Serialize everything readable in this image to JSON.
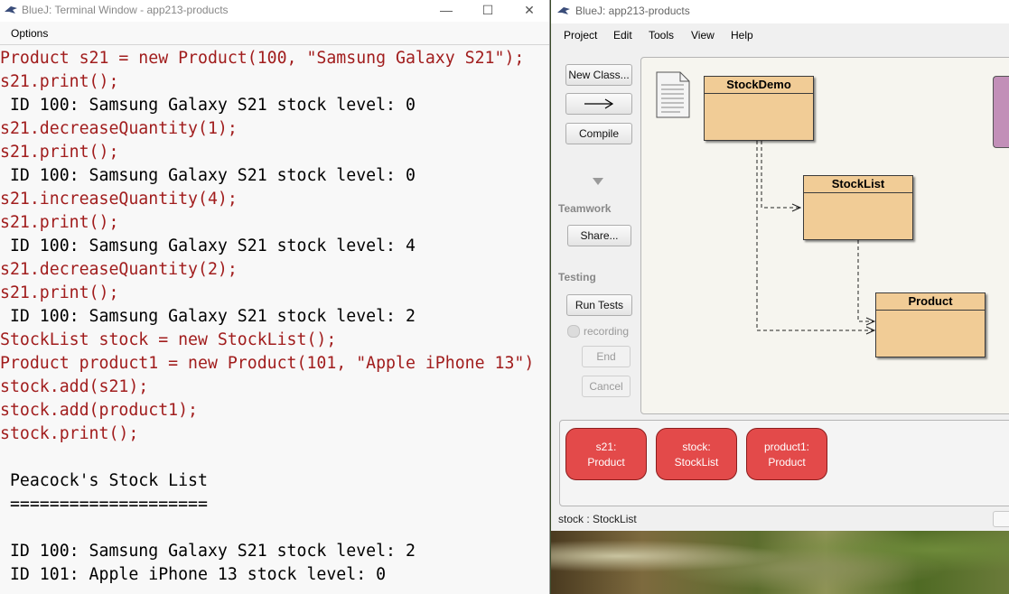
{
  "terminal": {
    "title": "BlueJ: Terminal Window - app213-products",
    "menu": "Options",
    "lines": [
      {
        "kind": "in",
        "text": "Product s21 = new Product(100, \"Samsung Galaxy S21\");"
      },
      {
        "kind": "in",
        "text": "s21.print();"
      },
      {
        "kind": "out",
        "text": " ID 100: Samsung Galaxy S21 stock level: 0"
      },
      {
        "kind": "in",
        "text": "s21.decreaseQuantity(1);"
      },
      {
        "kind": "in",
        "text": "s21.print();"
      },
      {
        "kind": "out",
        "text": " ID 100: Samsung Galaxy S21 stock level: 0"
      },
      {
        "kind": "in",
        "text": "s21.increaseQuantity(4);"
      },
      {
        "kind": "in",
        "text": "s21.print();"
      },
      {
        "kind": "out",
        "text": " ID 100: Samsung Galaxy S21 stock level: 4"
      },
      {
        "kind": "in",
        "text": "s21.decreaseQuantity(2);"
      },
      {
        "kind": "in",
        "text": "s21.print();"
      },
      {
        "kind": "out",
        "text": " ID 100: Samsung Galaxy S21 stock level: 2"
      },
      {
        "kind": "in",
        "text": "StockList stock = new StockList();"
      },
      {
        "kind": "in",
        "text": "Product product1 = new Product(101, \"Apple iPhone 13\")"
      },
      {
        "kind": "in",
        "text": "stock.add(s21);"
      },
      {
        "kind": "in",
        "text": "stock.add(product1);"
      },
      {
        "kind": "in",
        "text": "stock.print();"
      },
      {
        "kind": "out",
        "text": ""
      },
      {
        "kind": "out",
        "text": " Peacock's Stock List"
      },
      {
        "kind": "out",
        "text": " ===================="
      },
      {
        "kind": "out",
        "text": ""
      },
      {
        "kind": "out",
        "text": " ID 100: Samsung Galaxy S21 stock level: 2"
      },
      {
        "kind": "out",
        "text": " ID 101: Apple iPhone 13 stock level: 0"
      }
    ],
    "icons": {
      "minimize": "minimize-icon",
      "maximize": "maximize-icon",
      "close": "close-icon"
    }
  },
  "bluej": {
    "title": "BlueJ:  app213-products",
    "menu": [
      "Project",
      "Edit",
      "Tools",
      "View",
      "Help"
    ],
    "toolbar": {
      "new_class": "New Class...",
      "compile": "Compile",
      "teamwork_label": "Teamwork",
      "share": "Share...",
      "testing_label": "Testing",
      "run_tests": "Run Tests",
      "recording": "recording",
      "end": "End",
      "cancel": "Cancel"
    },
    "classes": {
      "stockdemo": "StockDemo",
      "stocklist": "StockList",
      "product": "Product"
    },
    "objects": [
      {
        "name": "s21:",
        "type": "Product"
      },
      {
        "name": "stock:",
        "type": "StockList"
      },
      {
        "name": "product1:",
        "type": "Product"
      }
    ],
    "status": "stock : StockList",
    "colors": {
      "class_fill": "#f1cc96",
      "object_fill": "#e34a4a",
      "input_text": "#a11d1d"
    }
  }
}
